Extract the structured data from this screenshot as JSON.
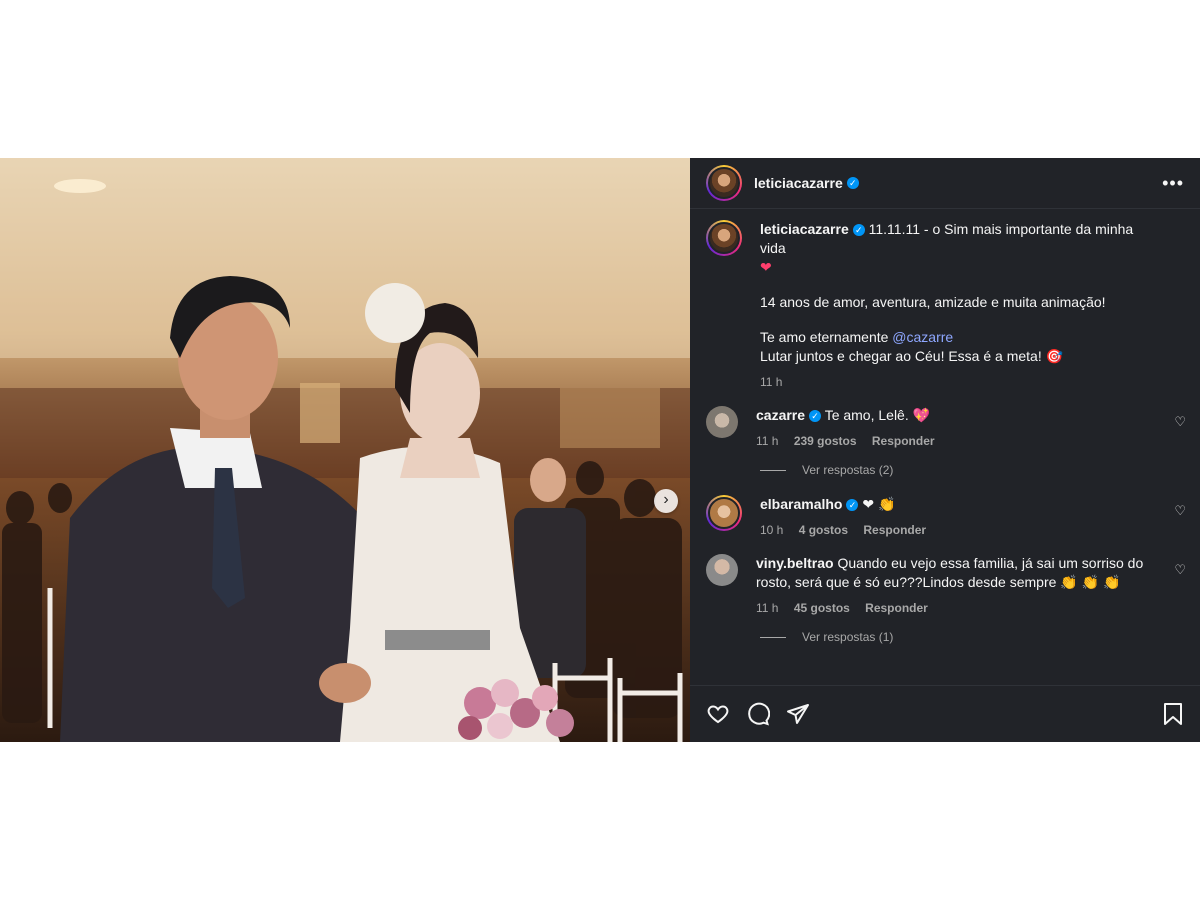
{
  "post": {
    "author": "leticiacazarre",
    "caption_line1": "11.11.11 - o Sim mais importante da minha vida",
    "caption_heart": "❤",
    "caption_para2": "14 anos de amor, aventura, amizade e muita animação!",
    "caption_para3_prefix": "Te amo eternamente ",
    "caption_mention": "@cazarre",
    "caption_para3_line2": "Lutar juntos e chegar ao Céu! Essa é a meta! 🎯",
    "time": "11 h"
  },
  "header": {
    "more_label": "•••"
  },
  "comments": [
    {
      "user": "cazarre",
      "verified": true,
      "text": "Te amo, Lelê. 💖",
      "time": "11 h",
      "likes": "239 gostos",
      "reply": "Responder",
      "view_replies": "Ver respostas (2)"
    },
    {
      "user": "elbaramalho",
      "verified": true,
      "text": "❤ 👏",
      "time": "10 h",
      "likes": "4 gostos",
      "reply": "Responder"
    },
    {
      "user": "viny.beltrao",
      "verified": false,
      "text": "Quando eu vejo essa familia, já sai um sorriso do rosto, será que é só eu???Lindos desde sempre 👏 👏 👏",
      "time": "11 h",
      "likes": "45 gostos",
      "reply": "Responder",
      "view_replies": "Ver respostas (1)"
    }
  ],
  "icons": {
    "verified": "✓",
    "next": "›",
    "like": "heart-icon",
    "comment": "comment-icon",
    "share": "share-icon",
    "save": "bookmark-icon"
  },
  "colors": {
    "panel_bg": "#212328",
    "verified": "#0095f6",
    "mention": "#8ea7ff"
  }
}
